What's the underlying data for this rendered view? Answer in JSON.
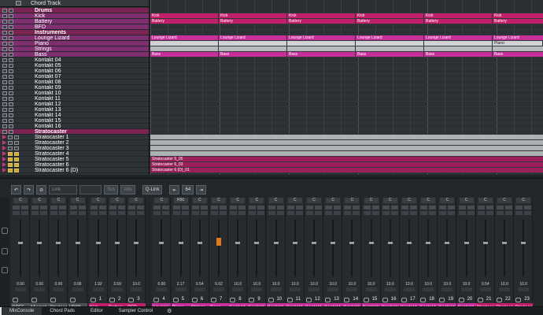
{
  "chord_track": {
    "label": "Chord Track"
  },
  "tracks": [
    {
      "name": "Drums",
      "type": "folder"
    },
    {
      "name": "Kick",
      "type": "inst"
    },
    {
      "name": "Battery",
      "type": "inst"
    },
    {
      "name": "BFD",
      "type": "inst"
    },
    {
      "name": "Instruments",
      "type": "folder"
    },
    {
      "name": "Lounge Lizard",
      "type": "inst"
    },
    {
      "name": "Piano",
      "type": "inst"
    },
    {
      "name": "Strings",
      "type": "inst"
    },
    {
      "name": "Bass",
      "type": "inst"
    },
    {
      "name": "Kontakt 04",
      "type": "plain"
    },
    {
      "name": "Kontakt 05",
      "type": "plain"
    },
    {
      "name": "Kontakt 06",
      "type": "plain"
    },
    {
      "name": "Kontakt 07",
      "type": "plain"
    },
    {
      "name": "Kontakt 08",
      "type": "plain"
    },
    {
      "name": "Kontakt 09",
      "type": "plain"
    },
    {
      "name": "Kontakt 10",
      "type": "plain"
    },
    {
      "name": "Kontakt 11",
      "type": "plain"
    },
    {
      "name": "Kontakt 12",
      "type": "plain"
    },
    {
      "name": "Kontakt 13",
      "type": "plain"
    },
    {
      "name": "Kontakt 14",
      "type": "plain"
    },
    {
      "name": "Kontakt 15",
      "type": "plain"
    },
    {
      "name": "Kontakt 16",
      "type": "plain"
    },
    {
      "name": "Stratocaster",
      "type": "folder"
    },
    {
      "name": "Stratocaster 1",
      "type": "audio"
    },
    {
      "name": "Stratocaster 2",
      "type": "audio"
    },
    {
      "name": "Stratocaster 3",
      "type": "audio"
    },
    {
      "name": "Stratocaster 4",
      "type": "audio"
    },
    {
      "name": "Stratocaster 5",
      "type": "audio"
    },
    {
      "name": "Stratocaster 6",
      "type": "audio"
    },
    {
      "name": "Stratocaster 6 (D)",
      "type": "audio"
    }
  ],
  "events": {
    "kick": "Kick",
    "battery": "Battery",
    "lounge": "Lounge Lizard",
    "piano": "Piano",
    "bass": "Bass",
    "s5": "Stratocaster 5_05",
    "s6": "Stratocaster 6_03",
    "s6d": "Stratocaster 6 (D)_01"
  },
  "mixer_toolbar": {
    "link": "Link",
    "sus": "Sus",
    "abs": "Abs",
    "qlink": "Q-Link",
    "zoom": "64"
  },
  "channels": [
    {
      "pan": "C",
      "val": "0.00",
      "num": "",
      "label": "GR55",
      "color": "#4a5055"
    },
    {
      "pan": "C",
      "val": "0.00",
      "num": "",
      "label": "Micropt",
      "color": "#4a5055"
    },
    {
      "pan": "C",
      "val": "0.00",
      "num": "",
      "label": "Stratoca",
      "color": "#4a5055"
    },
    {
      "pan": "C",
      "val": "0.00",
      "num": "",
      "label": "VD99",
      "color": "#4a5055"
    },
    {
      "pan": "C",
      "val": "1.92",
      "num": "1",
      "label": "Kick",
      "color": "#c21f6b"
    },
    {
      "pan": "C",
      "val": "3.59",
      "num": "2",
      "label": "Battery",
      "color": "#c21f6b"
    },
    {
      "pan": "C",
      "val": "10.0",
      "num": "3",
      "label": "BFD",
      "color": "#c21f6b"
    },
    {
      "pan": "C",
      "val": "0.00",
      "num": "4",
      "label": "Lounge",
      "color": "#c82f9a"
    },
    {
      "pan": "R50",
      "val": "2.17",
      "num": "5",
      "label": "Piano",
      "color": "#c82f9a"
    },
    {
      "pan": "C",
      "val": "0.54",
      "num": "6",
      "label": "Strings",
      "color": "#c82f9a"
    },
    {
      "pan": "C",
      "val": "6.02",
      "num": "7",
      "label": "Bass",
      "color": "#c82f9a"
    },
    {
      "pan": "C",
      "val": "10.0",
      "num": "8",
      "label": "Kontakt",
      "color": "#c82f9a"
    },
    {
      "pan": "C",
      "val": "10.0",
      "num": "9",
      "label": "Kontakt",
      "color": "#c82f9a"
    },
    {
      "pan": "C",
      "val": "10.0",
      "num": "10",
      "label": "Kontakt",
      "color": "#c82f9a"
    },
    {
      "pan": "C",
      "val": "10.0",
      "num": "11",
      "label": "Kontakt",
      "color": "#c82f9a"
    },
    {
      "pan": "C",
      "val": "10.0",
      "num": "12",
      "label": "Kontakt",
      "color": "#c82f9a"
    },
    {
      "pan": "C",
      "val": "10.0",
      "num": "13",
      "label": "Kontakt",
      "color": "#c82f9a"
    },
    {
      "pan": "C",
      "val": "10.0",
      "num": "14",
      "label": "Kontakt",
      "color": "#c82f9a"
    },
    {
      "pan": "C",
      "val": "10.0",
      "num": "15",
      "label": "Kontakt",
      "color": "#c82f9a"
    },
    {
      "pan": "C",
      "val": "10.0",
      "num": "16",
      "label": "Kontakt",
      "color": "#c82f9a"
    },
    {
      "pan": "C",
      "val": "10.0",
      "num": "17",
      "label": "Kontakt",
      "color": "#c82f9a"
    },
    {
      "pan": "C",
      "val": "10.0",
      "num": "18",
      "label": "Kontakt",
      "color": "#c82f9a"
    },
    {
      "pan": "C",
      "val": "10.0",
      "num": "19",
      "label": "Kontakt",
      "color": "#c82f9a"
    },
    {
      "pan": "C",
      "val": "10.0",
      "num": "20",
      "label": "Kontakt",
      "color": "#c82f9a"
    },
    {
      "pan": "C",
      "val": "0.54",
      "num": "21",
      "label": "Stratoca",
      "color": "#c21f6b"
    },
    {
      "pan": "C",
      "val": "10.0",
      "num": "22",
      "label": "Stratoca",
      "color": "#c21f6b"
    },
    {
      "pan": "C",
      "val": "10.0",
      "num": "23",
      "label": "Stratoca",
      "color": "#c21f6b"
    }
  ],
  "bottom_tabs": [
    "MixConsole",
    "Chord Pads",
    "Editor",
    "Sampler Control"
  ]
}
